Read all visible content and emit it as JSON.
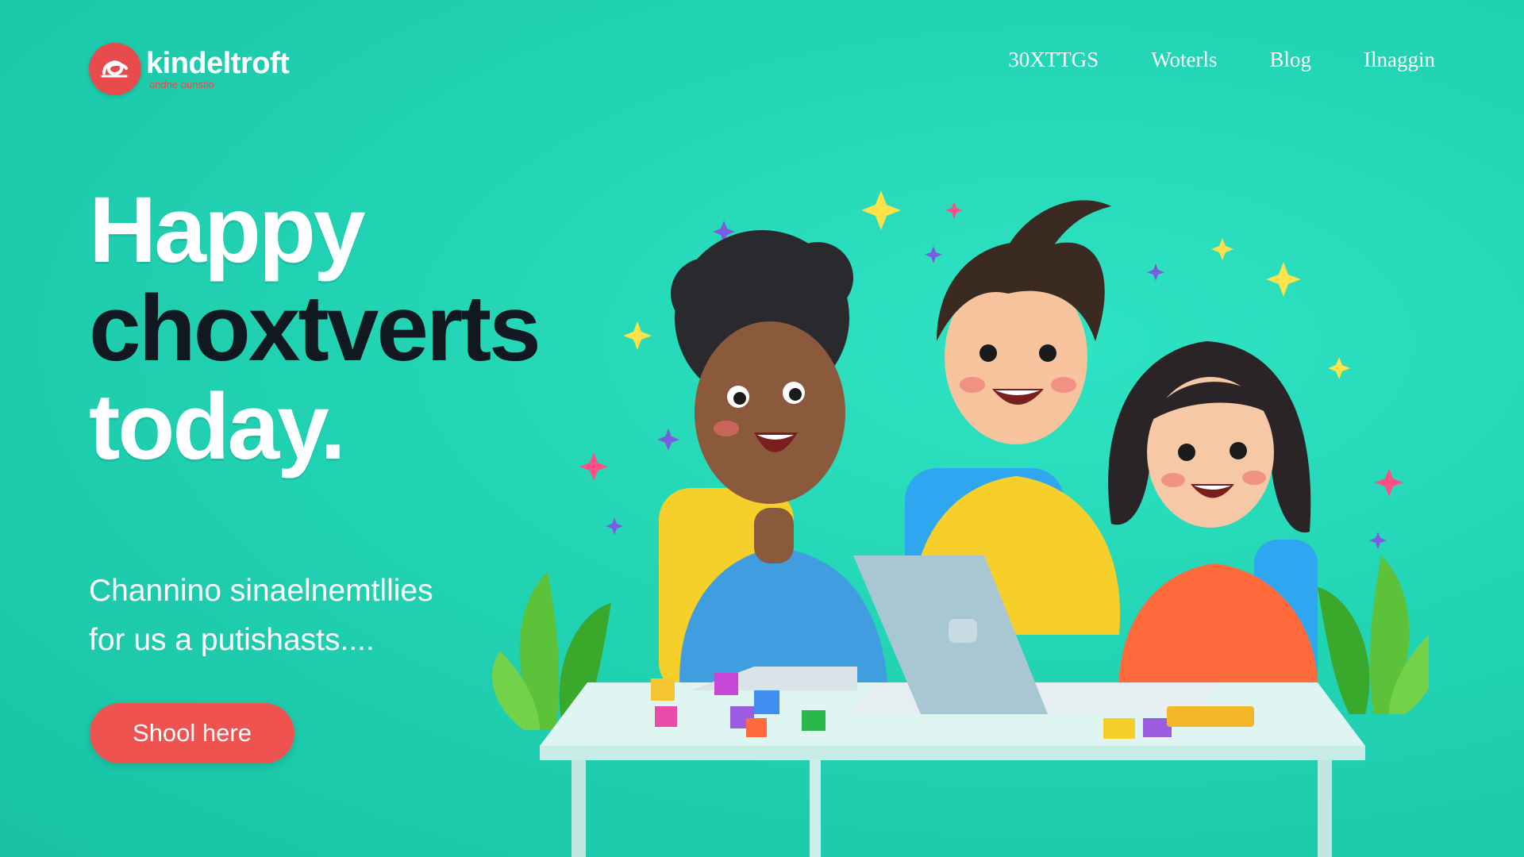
{
  "brand": {
    "name": "kindeltroft",
    "tagline": "ondne ounstio"
  },
  "nav": {
    "items": [
      {
        "label": "30XTTGS"
      },
      {
        "label": "Woterls"
      },
      {
        "label": "Blog"
      },
      {
        "label": "Ilnaggin"
      }
    ]
  },
  "hero": {
    "headline_line1": "Happy",
    "headline_line2": "choxtverts",
    "headline_line3": "today.",
    "subtitle_line1": "Channino sinaelnemtllies",
    "subtitle_line2": "for us a putishasts....",
    "cta_label": "Shool here"
  },
  "colors": {
    "background": "#22d4b4",
    "accent": "#ee5350",
    "headline_dark": "#121820",
    "text_light": "#ffffff"
  },
  "illustration": {
    "description_icon": "children-at-laptop-illustration"
  }
}
